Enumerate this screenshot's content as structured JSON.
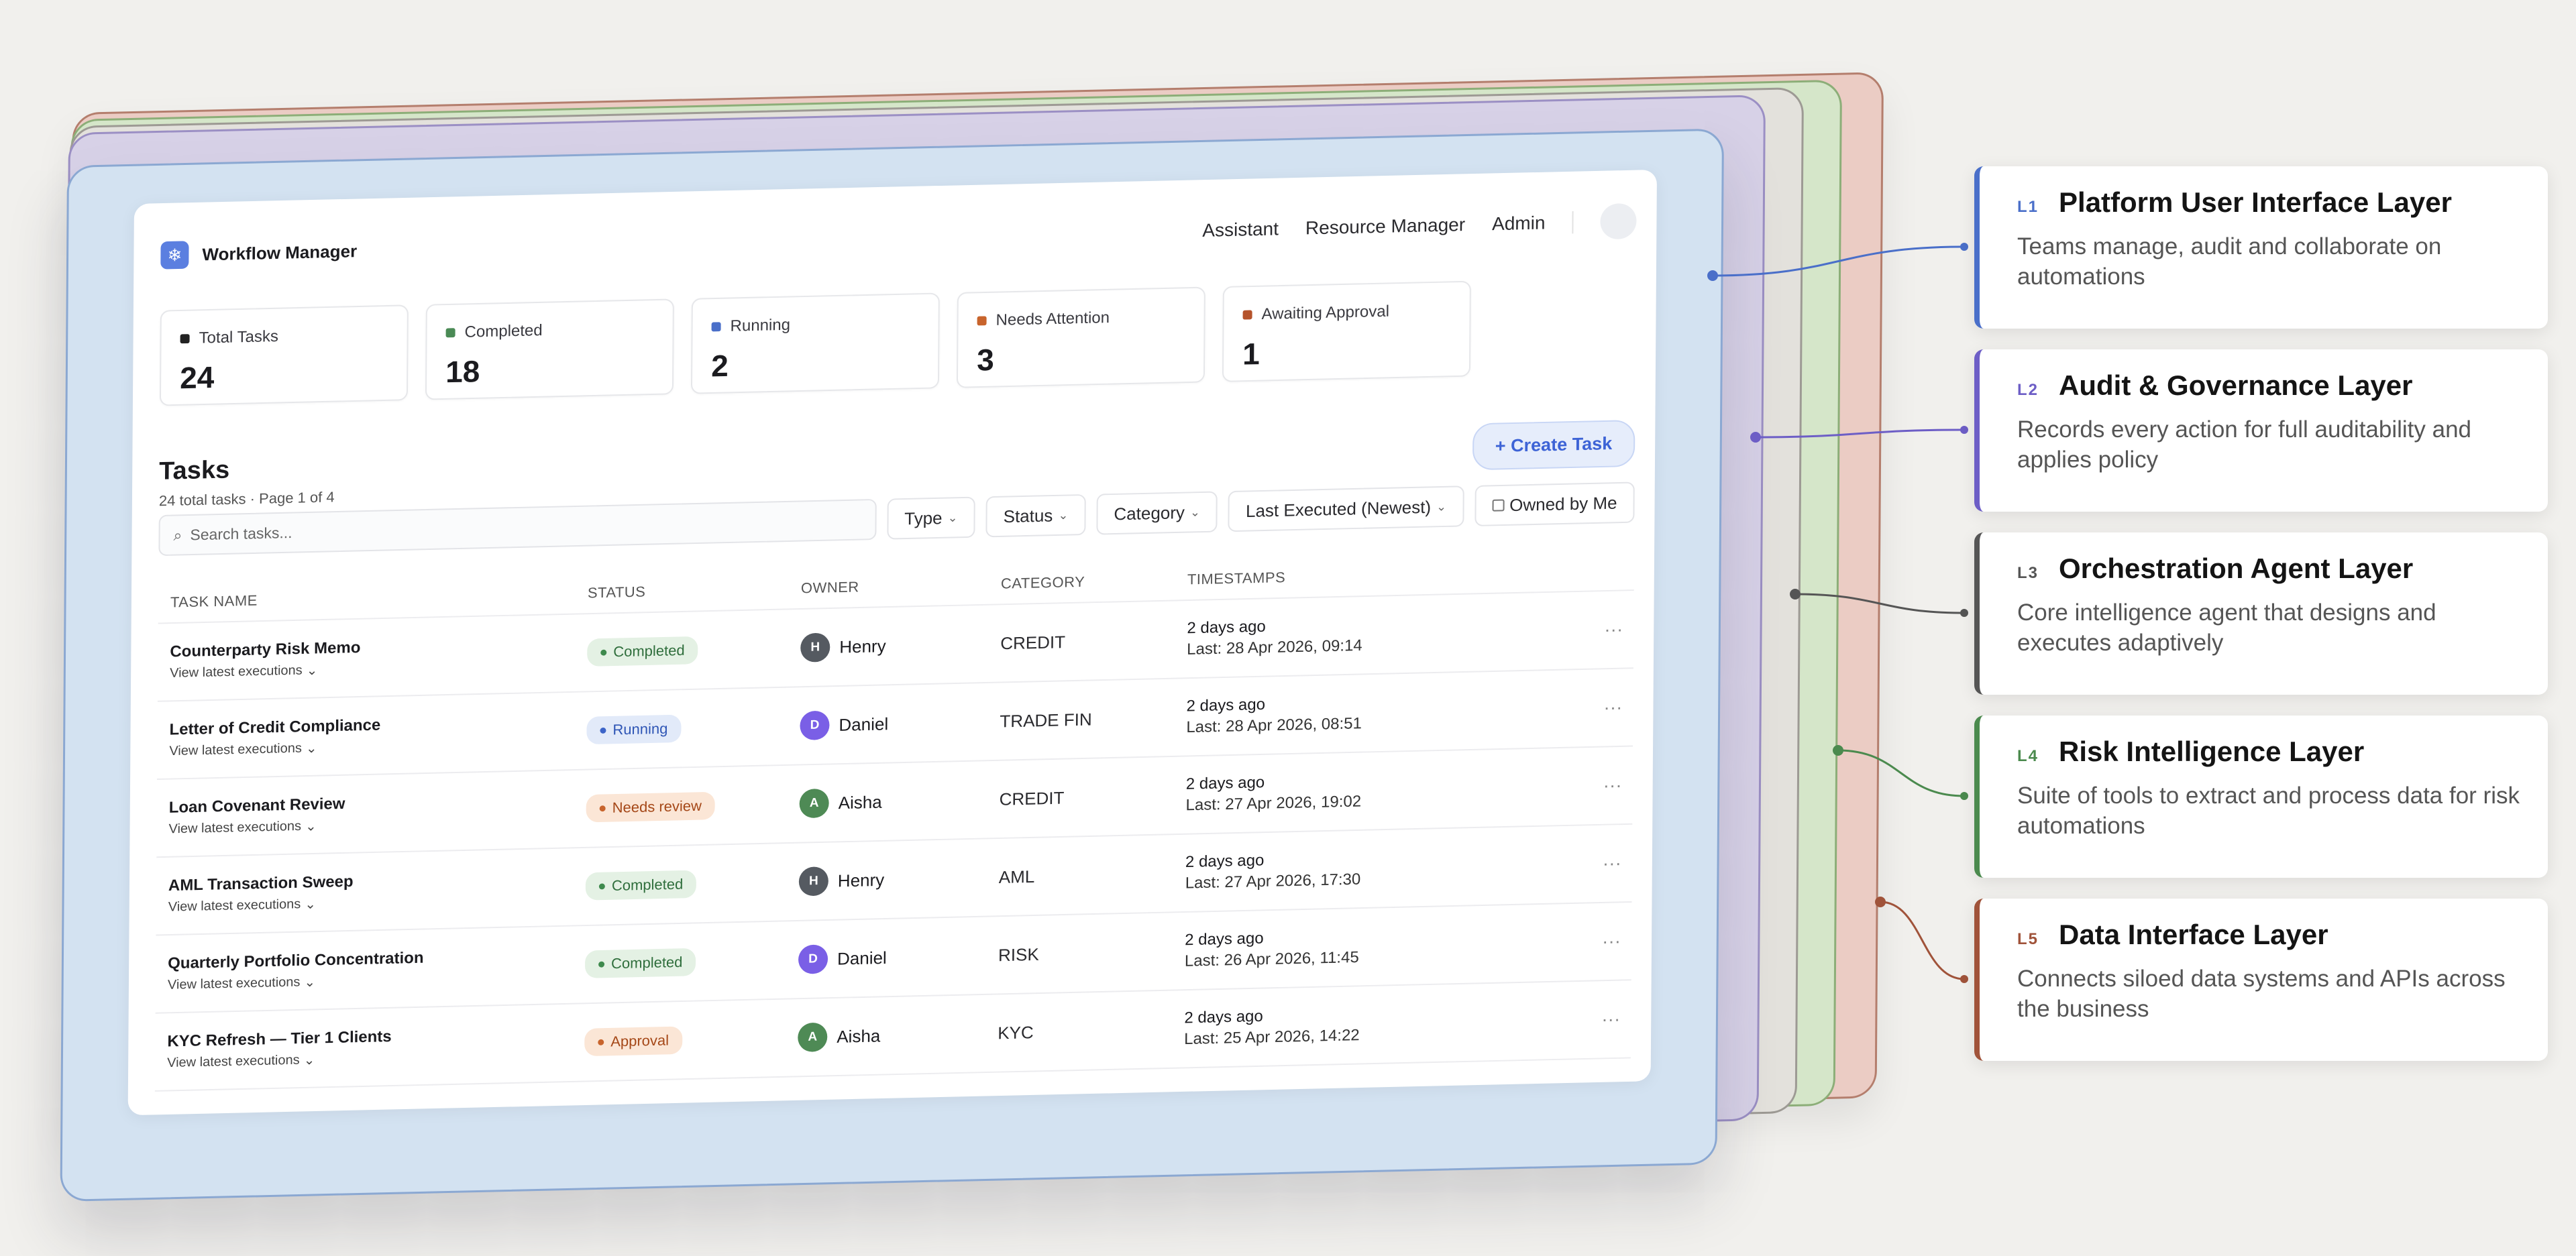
{
  "app": {
    "title": "Workflow Manager",
    "logo_icon": "snowflake-icon",
    "nav": [
      "Assistant",
      "Resource Manager",
      "Admin"
    ]
  },
  "stats": [
    {
      "label": "Total Tasks",
      "value": "24",
      "color": "#222222"
    },
    {
      "label": "Completed",
      "value": "18",
      "color": "#4a8a55"
    },
    {
      "label": "Running",
      "value": "2",
      "color": "#4a6fc9"
    },
    {
      "label": "Needs Attention",
      "value": "3",
      "color": "#c8642c"
    },
    {
      "label": "Awaiting Approval",
      "value": "1",
      "color": "#b5532b"
    }
  ],
  "tasks": {
    "title": "Tasks",
    "subtitle": "24 total tasks · Page 1 of 4",
    "create_label": "+ Create Task",
    "search_placeholder": "Search tasks...",
    "filters": [
      "Type",
      "Status",
      "Category",
      "Last Executed (Newest)"
    ],
    "owned_label": "Owned by Me",
    "columns": [
      "TASK NAME",
      "STATUS",
      "OWNER",
      "CATEGORY",
      "TIMESTAMPS"
    ],
    "link_label": "View latest executions",
    "rows": [
      {
        "name": "Counterparty Risk Memo",
        "status": "Completed",
        "owner": "Henry",
        "initial": "H",
        "category": "CREDIT",
        "relative": "2 days ago",
        "last": "Last: 28 Apr 2026, 09:14"
      },
      {
        "name": "Letter of Credit Compliance",
        "status": "Running",
        "owner": "Daniel",
        "initial": "D",
        "category": "TRADE FIN",
        "relative": "2 days ago",
        "last": "Last: 28 Apr 2026, 08:51"
      },
      {
        "name": "Loan Covenant Review",
        "status": "Needs review",
        "owner": "Aisha",
        "initial": "A",
        "category": "CREDIT",
        "relative": "2 days ago",
        "last": "Last: 27 Apr 2026, 19:02"
      },
      {
        "name": "AML Transaction Sweep",
        "status": "Completed",
        "owner": "Henry",
        "initial": "H",
        "category": "AML",
        "relative": "2 days ago",
        "last": "Last: 27 Apr 2026, 17:30"
      },
      {
        "name": "Quarterly Portfolio Concentration",
        "status": "Completed",
        "owner": "Daniel",
        "initial": "D",
        "category": "RISK",
        "relative": "2 days ago",
        "last": "Last: 26 Apr 2026, 11:45"
      },
      {
        "name": "KYC Refresh — Tier 1 Clients",
        "status": "Approval",
        "owner": "Aisha",
        "initial": "A",
        "category": "KYC",
        "relative": "2 days ago",
        "last": "Last: 25 Apr 2026, 14:22"
      }
    ]
  },
  "status_styles": {
    "Completed": {
      "bg": "#e4f1e4",
      "fg": "#2f6e3c",
      "dot": "#3e8a4d"
    },
    "Running": {
      "bg": "#e2eaf9",
      "fg": "#2e55b5",
      "dot": "#3c64c8"
    },
    "Needs review": {
      "bg": "#fbe6d6",
      "fg": "#a54818",
      "dot": "#c8642c"
    },
    "Approval": {
      "bg": "#fbe6d6",
      "fg": "#a54818",
      "dot": "#c8642c"
    }
  },
  "owner_colors": {
    "Henry": "#555a61",
    "Daniel": "#7a5fe6",
    "Aisha": "#4e8a55"
  },
  "layers": [
    {
      "code": "L1",
      "title": "Platform User Interface Layer",
      "desc": "Teams manage, audit and collaborate on automations",
      "color": "#4a6fc9"
    },
    {
      "code": "L2",
      "title": "Audit & Governance Layer",
      "desc": "Records every action for full auditability and applies policy",
      "color": "#6d5ec6"
    },
    {
      "code": "L3",
      "title": "Orchestration Agent Layer",
      "desc": "Core intelligence agent that designs and executes adaptively",
      "color": "#555555"
    },
    {
      "code": "L4",
      "title": "Risk Intelligence Layer",
      "desc": "Suite of tools to extract and process data for risk automations",
      "color": "#4b8a4e"
    },
    {
      "code": "L5",
      "title": "Data Interface Layer",
      "desc": "Connects siloed data systems and APIs across the business",
      "color": "#a0533a"
    }
  ]
}
